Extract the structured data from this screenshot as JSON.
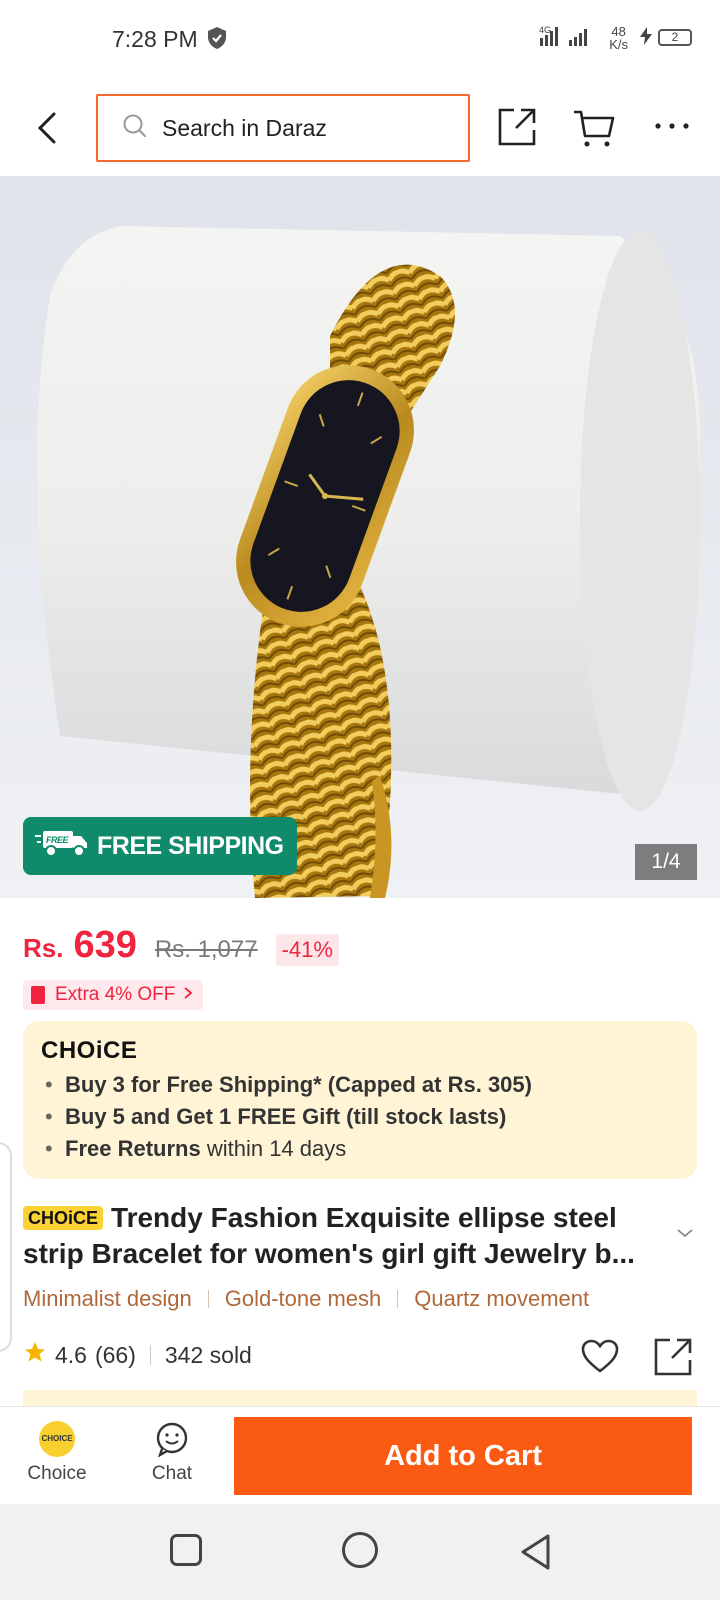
{
  "status_bar": {
    "time": "7:28 PM",
    "network": "4G",
    "speed_value": "48",
    "speed_unit": "K/s",
    "battery": "2"
  },
  "header": {
    "search_placeholder": "Search in Daraz",
    "icons": [
      "back-icon",
      "search-icon",
      "share-icon",
      "cart-icon",
      "more-icon"
    ]
  },
  "gallery": {
    "free_shipping_label": "FREE SHIPPING",
    "free_badge": "FREE",
    "counter": "1/4"
  },
  "price": {
    "currency": "Rs.",
    "current": "639",
    "original": "Rs. 1,077",
    "discount": "-41%"
  },
  "promo": {
    "extra_off": "Extra 4% OFF"
  },
  "choice_box": {
    "logo": "CHOiCE",
    "items": [
      {
        "bold": "Buy 3 for  Free Shipping* (Capped at Rs. 305)",
        "rest": ""
      },
      {
        "bold": "Buy 5 and Get 1 FREE Gift (till stock lasts)",
        "rest": ""
      },
      {
        "bold": "Free Returns",
        "rest": " within 14 days"
      }
    ]
  },
  "product": {
    "badge": "CHOiCE",
    "title_line1": "Trendy Fashion Exquisite ellipse steel",
    "title_line2": "strip Bracelet for women's girl gift Jewelry b...",
    "tags": [
      "Minimalist design",
      "Gold-tone mesh",
      "Quartz movement"
    ],
    "rating": "4.6",
    "reviews": "(66)",
    "sold": "342 sold"
  },
  "bottom_bar": {
    "choice_label": "Choice",
    "choice_icon_text": "CHOICE",
    "chat_label": "Chat",
    "add_to_cart": "Add to Cart"
  },
  "colors": {
    "accent": "#fa5a12",
    "price": "#f0243f",
    "shipping_badge": "#0f8a6a",
    "choice_bg": "#fff4d6",
    "tag_text": "#b0683a"
  }
}
